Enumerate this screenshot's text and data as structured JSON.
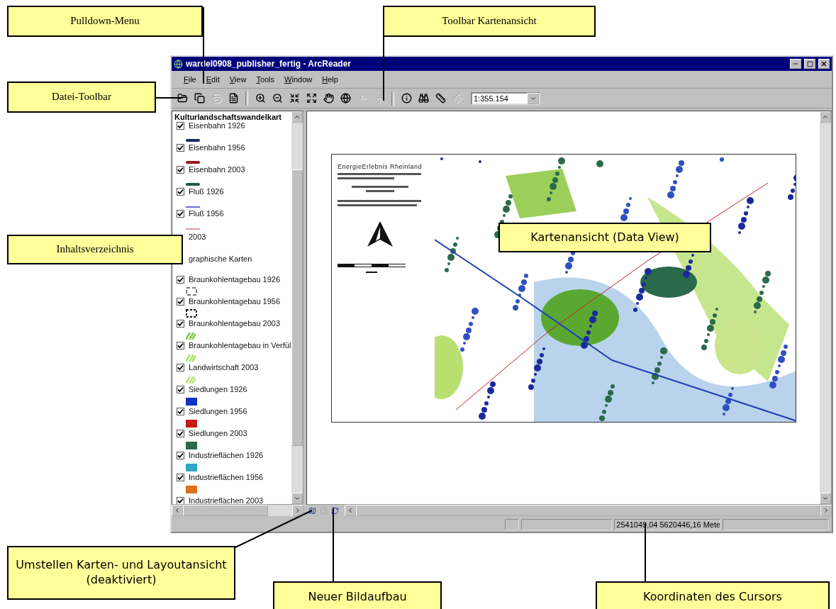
{
  "window": {
    "title": "wardel0908_publisher_fertig - ArcReader"
  },
  "menu": [
    {
      "label": "File"
    },
    {
      "label": "Edit"
    },
    {
      "label": "View"
    },
    {
      "label": "Tools"
    },
    {
      "label": "Window"
    },
    {
      "label": "Help"
    }
  ],
  "toolbar": [
    {
      "kind": "open",
      "disabled": false
    },
    {
      "kind": "copy",
      "disabled": false
    },
    {
      "kind": "print",
      "disabled": true
    },
    {
      "kind": "page",
      "disabled": false
    },
    {
      "kind": "sep"
    },
    {
      "kind": "zoom_in",
      "disabled": false
    },
    {
      "kind": "zoom_out",
      "disabled": false
    },
    {
      "kind": "fixed_in",
      "disabled": false
    },
    {
      "kind": "fixed_out",
      "disabled": false
    },
    {
      "kind": "pan",
      "disabled": false
    },
    {
      "kind": "globe",
      "disabled": false
    },
    {
      "kind": "back",
      "disabled": true
    },
    {
      "kind": "forward",
      "disabled": true
    },
    {
      "kind": "sep"
    },
    {
      "kind": "info",
      "disabled": false
    },
    {
      "kind": "find",
      "disabled": false
    },
    {
      "kind": "measure",
      "disabled": false
    },
    {
      "kind": "flash",
      "disabled": true
    }
  ],
  "scale_field": {
    "value": "1:355.154"
  },
  "toc": {
    "title": "Kulturlandschaftswandelkart",
    "items": [
      {
        "kind": "line",
        "label": "Eisenbahn 1926",
        "checked": true,
        "color": "#1a2a6c"
      },
      {
        "kind": "line",
        "label": "Eisenbahn 1956",
        "checked": true,
        "color": "#9a1a1a"
      },
      {
        "kind": "line",
        "label": "Eisenbahn 2003",
        "checked": true,
        "color": "#1f5a3a"
      },
      {
        "kind": "thin_line",
        "label": "Fluß 1926",
        "checked": true,
        "color": "#6a6ae0"
      },
      {
        "kind": "thin_line",
        "label": "Fluß 1956",
        "checked": true,
        "color": "#e0a0a0"
      },
      {
        "kind": "covered",
        "label": "2003"
      },
      {
        "kind": "group",
        "label": "graphische Karten"
      },
      {
        "kind": "dashed_outline",
        "label": "Braunkohlentagebau 1926",
        "checked": true,
        "color": "#777777"
      },
      {
        "kind": "dotted_outline",
        "label": "Braunkohlentagebau 1956",
        "checked": true,
        "color": "#111111"
      },
      {
        "kind": "hatch",
        "label": "Braunkohlentagebau 2003",
        "checked": true,
        "color": "#88c040"
      },
      {
        "kind": "hatch",
        "label": "Braunkohlentagebau in Verfül",
        "checked": true,
        "color": "#a8e060"
      },
      {
        "kind": "hatch",
        "label": "Landwirtschaft 2003",
        "checked": true,
        "color": "#b8e070"
      },
      {
        "kind": "fill",
        "label": "Siedlungen 1926",
        "checked": true,
        "color": "#1030c0"
      },
      {
        "kind": "fill",
        "label": "Siedlungen 1956",
        "checked": true,
        "color": "#c02010"
      },
      {
        "kind": "fill",
        "label": "Siedlungen 2003",
        "checked": true,
        "color": "#2a6a4a"
      },
      {
        "kind": "fill",
        "label": "Industrieflächen 1926",
        "checked": true,
        "color": "#30a8c8"
      },
      {
        "kind": "fill",
        "label": "Industrieflächen 1956",
        "checked": true,
        "color": "#e07018"
      },
      {
        "kind": "cut",
        "label": "Industrieflächen 2003",
        "checked": true
      }
    ]
  },
  "map": {
    "layout_title": "EnergieErlebnis Rheinland"
  },
  "view_buttons": [
    {
      "kind": "data_view",
      "disabled": false
    },
    {
      "kind": "layout_view",
      "disabled": true
    },
    {
      "kind": "refresh",
      "disabled": false
    }
  ],
  "status_bar": {
    "coordinates": "2541049,04  5620446,16 Mete"
  },
  "callouts": [
    {
      "text": "Pulldown-Menu"
    },
    {
      "text": "Toolbar Kartenansicht"
    },
    {
      "text": "Datei-Toolbar"
    },
    {
      "text": "Inhaltsverzeichnis"
    },
    {
      "text": "Kartenansicht (Data View)"
    },
    {
      "text": "Umstellen Karten- und Layoutansicht (deaktiviert)"
    },
    {
      "text": "Neuer Bildaufbau"
    },
    {
      "text": "Koordinaten des Cursors"
    }
  ]
}
